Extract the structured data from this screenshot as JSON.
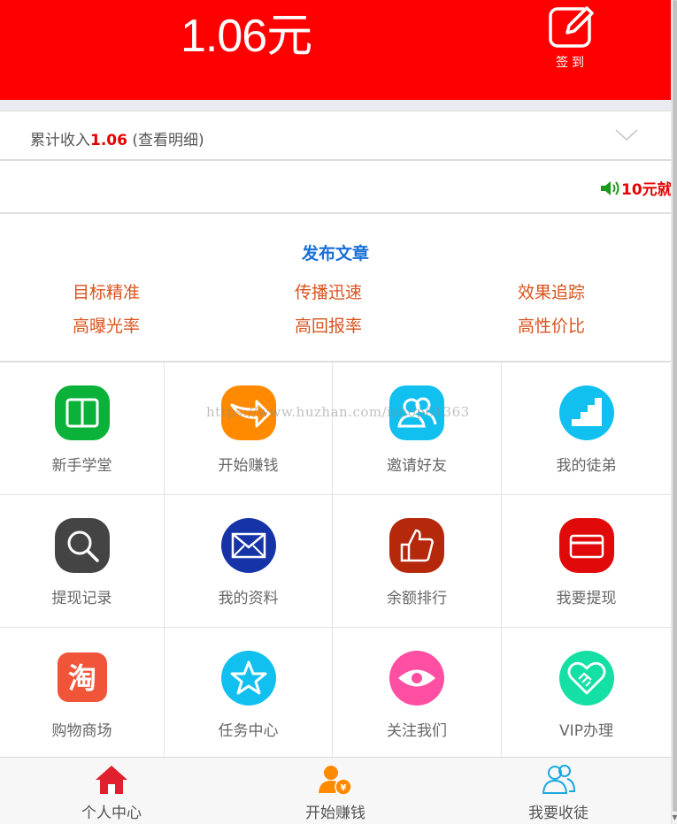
{
  "header": {
    "balance": "1.06元",
    "signin_label": "签到",
    "bg_color": "#ff0000"
  },
  "income": {
    "prefix": "累计收入",
    "value": "1.06",
    "link": "(查看明细)"
  },
  "notice": {
    "text": "10元就",
    "icon": "speaker-icon"
  },
  "publish": {
    "title": "发布文章",
    "features": [
      "目标精准",
      "传播迅速",
      "效果追踪",
      "高曝光率",
      "高回报率",
      "高性价比"
    ]
  },
  "grid": {
    "items": [
      {
        "label": "新手学堂",
        "icon": "book-icon",
        "color": "#0bb23a"
      },
      {
        "label": "开始赚钱",
        "icon": "share-arrow-icon",
        "color": "#ff8a00"
      },
      {
        "label": "邀请好友",
        "icon": "friends-icon",
        "color": "#12c0f0"
      },
      {
        "label": "我的徒弟",
        "icon": "stairs-icon",
        "color": "#12c0f0"
      },
      {
        "label": "提现记录",
        "icon": "search-icon",
        "color": "#444444"
      },
      {
        "label": "我的资料",
        "icon": "mail-icon",
        "color": "#1634a8"
      },
      {
        "label": "余额排行",
        "icon": "thumbs-up-icon",
        "color": "#b5280c"
      },
      {
        "label": "我要提现",
        "icon": "card-icon",
        "color": "#e10a0a"
      },
      {
        "label": "购物商场",
        "icon": "taobao-icon",
        "color": "#f0553a"
      },
      {
        "label": "任务中心",
        "icon": "star-icon",
        "color": "#12c0f0"
      },
      {
        "label": "关注我们",
        "icon": "eye-icon",
        "color": "#ff4fa3"
      },
      {
        "label": "VIP办理",
        "icon": "handshake-icon",
        "color": "#14e0a6"
      }
    ]
  },
  "watermark": "https://www.huzhan.com/ishop61363",
  "tabbar": {
    "items": [
      {
        "label": "个人中心",
        "icon": "home-icon"
      },
      {
        "label": "开始赚钱",
        "icon": "user-money-icon"
      },
      {
        "label": "我要收徒",
        "icon": "users-icon"
      }
    ]
  }
}
